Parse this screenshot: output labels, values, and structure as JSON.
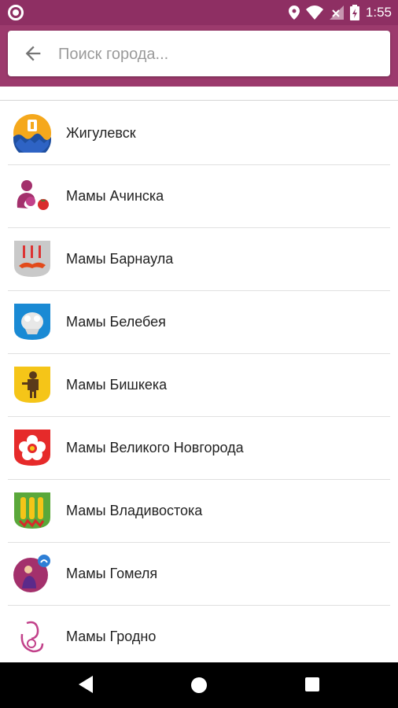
{
  "status": {
    "time": "1:55"
  },
  "search": {
    "placeholder": "Поиск города..."
  },
  "cities": [
    {
      "label": "Жигулевск",
      "icon": "zhigulevsk-emblem-icon"
    },
    {
      "label": "Мамы Ачинска",
      "icon": "mother-child-logo-icon"
    },
    {
      "label": "Мамы Барнаула",
      "icon": "barnaul-emblem-icon"
    },
    {
      "label": "Мамы Белебея",
      "icon": "belebey-emblem-icon"
    },
    {
      "label": "Мамы Бишкека",
      "icon": "bear-emblem-icon"
    },
    {
      "label": "Мамы Великого Новгорода",
      "icon": "rose-emblem-icon"
    },
    {
      "label": "Мамы Владивостока",
      "icon": "wheat-emblem-icon"
    },
    {
      "label": "Мамы Гомеля",
      "icon": "gomel-mother-logo-icon"
    },
    {
      "label": "Мамы Гродно",
      "icon": "mother-outline-logo-icon"
    }
  ],
  "colors": {
    "statusbar": "#8e2f63",
    "header": "#9c3a6d"
  }
}
